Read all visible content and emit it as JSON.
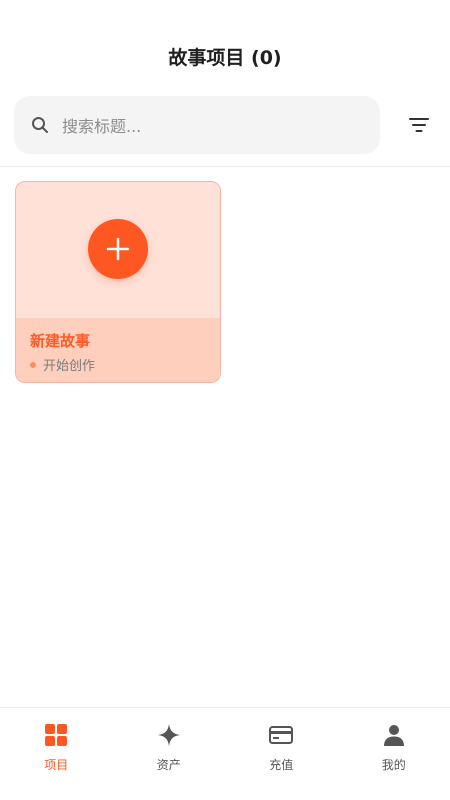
{
  "header": {
    "title": "故事项目 (0)"
  },
  "search": {
    "placeholder": "搜索标题..."
  },
  "projects": {
    "new_card": {
      "title": "新建故事",
      "subtitle": "开始创作"
    }
  },
  "tabbar": {
    "items": [
      {
        "label": "项目",
        "icon": "grid-icon",
        "active": true
      },
      {
        "label": "资产",
        "icon": "sparkle-icon",
        "active": false
      },
      {
        "label": "充值",
        "icon": "credit-card-icon",
        "active": false
      },
      {
        "label": "我的",
        "icon": "person-icon",
        "active": false
      }
    ]
  },
  "colors": {
    "accent": "#ff5722",
    "card_bg": "#ffe1d8",
    "card_footer": "#ffcfbe"
  }
}
